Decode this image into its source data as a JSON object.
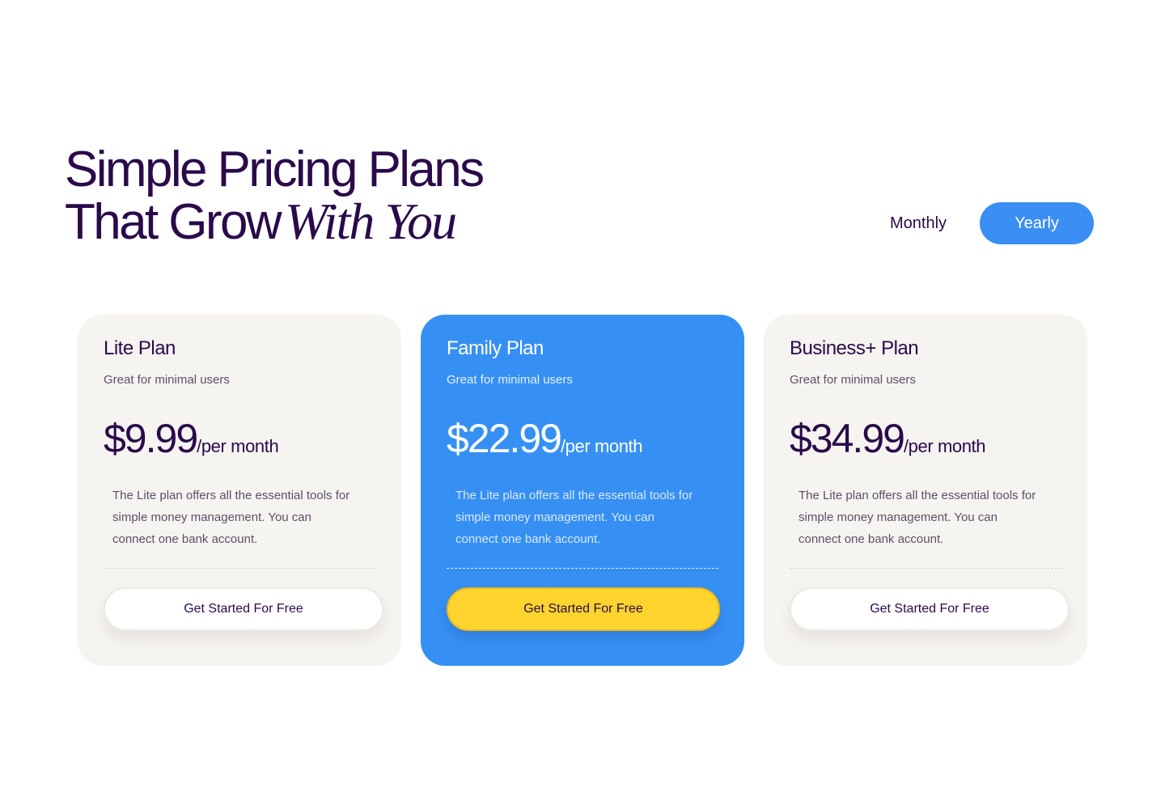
{
  "header": {
    "title_line1": "Simple Pricing Plans",
    "title_line2": "That Grow",
    "title_accent": "With You"
  },
  "billing_toggle": {
    "monthly_label": "Monthly",
    "yearly_label": "Yearly",
    "selected": "Yearly"
  },
  "plans": [
    {
      "name": "Lite Plan",
      "subtitle": "Great for minimal users",
      "price": "$9.99",
      "period": "/per month",
      "description": "The Lite plan offers all the essential tools for simple money management. You can connect one bank account.",
      "cta_label": "Get Started For Free"
    },
    {
      "name": "Family Plan",
      "subtitle": "Great for minimal users",
      "price": "$22.99",
      "period": "/per month",
      "description": "The Lite plan offers all the essential tools for simple money management. You can connect one bank account.",
      "cta_label": "Get Started For Free"
    },
    {
      "name": "Business+ Plan",
      "subtitle": "Great for minimal users",
      "price": "$34.99",
      "period": "/per month",
      "description": "The Lite plan offers all the essential tools for simple money management. You can connect one bank account.",
      "cta_label": "Get Started For Free"
    }
  ],
  "colors": {
    "heading": "#2a0a4a",
    "accent_blue": "#3690f4",
    "cta_yellow": "#ffd42e",
    "card_bg": "#f6f4f0"
  }
}
